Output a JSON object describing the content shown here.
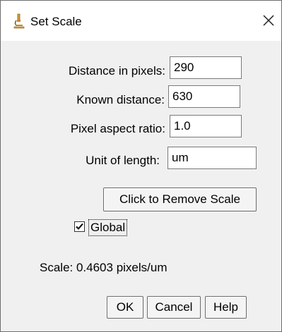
{
  "window": {
    "title": "Set Scale",
    "icon": "microscope-icon",
    "close_symbol": "✕"
  },
  "fields": {
    "distance_in_pixels": {
      "label": "Distance in pixels:",
      "value": "290"
    },
    "known_distance": {
      "label": "Known distance:",
      "value": "630"
    },
    "pixel_aspect_ratio": {
      "label": "Pixel aspect ratio:",
      "value": "1.0"
    },
    "unit_of_length": {
      "label": "Unit of length:",
      "value": "um"
    }
  },
  "remove_scale_button": {
    "label": "Click to Remove Scale"
  },
  "global_checkbox": {
    "label": "Global",
    "checked": true
  },
  "scale_info": "Scale: 0.4603 pixels/um",
  "buttons": {
    "ok": "OK",
    "cancel": "Cancel",
    "help": "Help"
  },
  "colors": {
    "dialog_background": "#f0f0f0",
    "titlebar_background": "#ffffff",
    "icon_accent": "#d8a23a"
  }
}
